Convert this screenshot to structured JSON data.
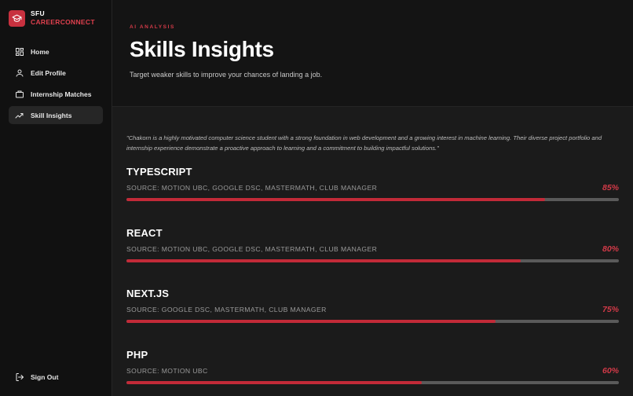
{
  "brand": {
    "line1": "SFU",
    "line2": "CAREERCONNECT",
    "logo_icon": "graduation-cap-icon",
    "accent": "#c8313f"
  },
  "nav": {
    "items": [
      {
        "label": "Home",
        "icon": "dashboard-grid-icon",
        "active": false
      },
      {
        "label": "Edit Profile",
        "icon": "user-icon",
        "active": false
      },
      {
        "label": "Internship Matches",
        "icon": "briefcase-icon",
        "active": false
      },
      {
        "label": "Skill Insights",
        "icon": "trending-line-icon",
        "active": true
      }
    ],
    "signout_label": "Sign Out"
  },
  "hero": {
    "eyebrow": "AI ANALYSIS",
    "title": "Skills Insights",
    "subtitle": "Target weaker skills to improve your chances of landing a job."
  },
  "summary": "\"Chakorn is a highly motivated computer science student with a strong foundation in web development and a growing interest in machine learning. Their diverse project portfolio and internship experience demonstrate a proactive approach to learning and a commitment to building impactful solutions.\"",
  "skills": [
    {
      "name": "TYPESCRIPT",
      "source": "SOURCE: MOTION UBC, GOOGLE DSC, MASTERMATH, CLUB MANAGER",
      "percent_label": "85%",
      "percent": 85
    },
    {
      "name": "REACT",
      "source": "SOURCE: MOTION UBC, GOOGLE DSC, MASTERMATH, CLUB MANAGER",
      "percent_label": "80%",
      "percent": 80
    },
    {
      "name": "NEXT.JS",
      "source": "SOURCE: GOOGLE DSC, MASTERMATH, CLUB MANAGER",
      "percent_label": "75%",
      "percent": 75
    },
    {
      "name": "PHP",
      "source": "SOURCE: MOTION UBC",
      "percent_label": "60%",
      "percent": 60
    }
  ],
  "colors": {
    "bar_fill": "#c22a38",
    "bar_track": "#5a5a5a",
    "accent_text": "#d33a48"
  }
}
